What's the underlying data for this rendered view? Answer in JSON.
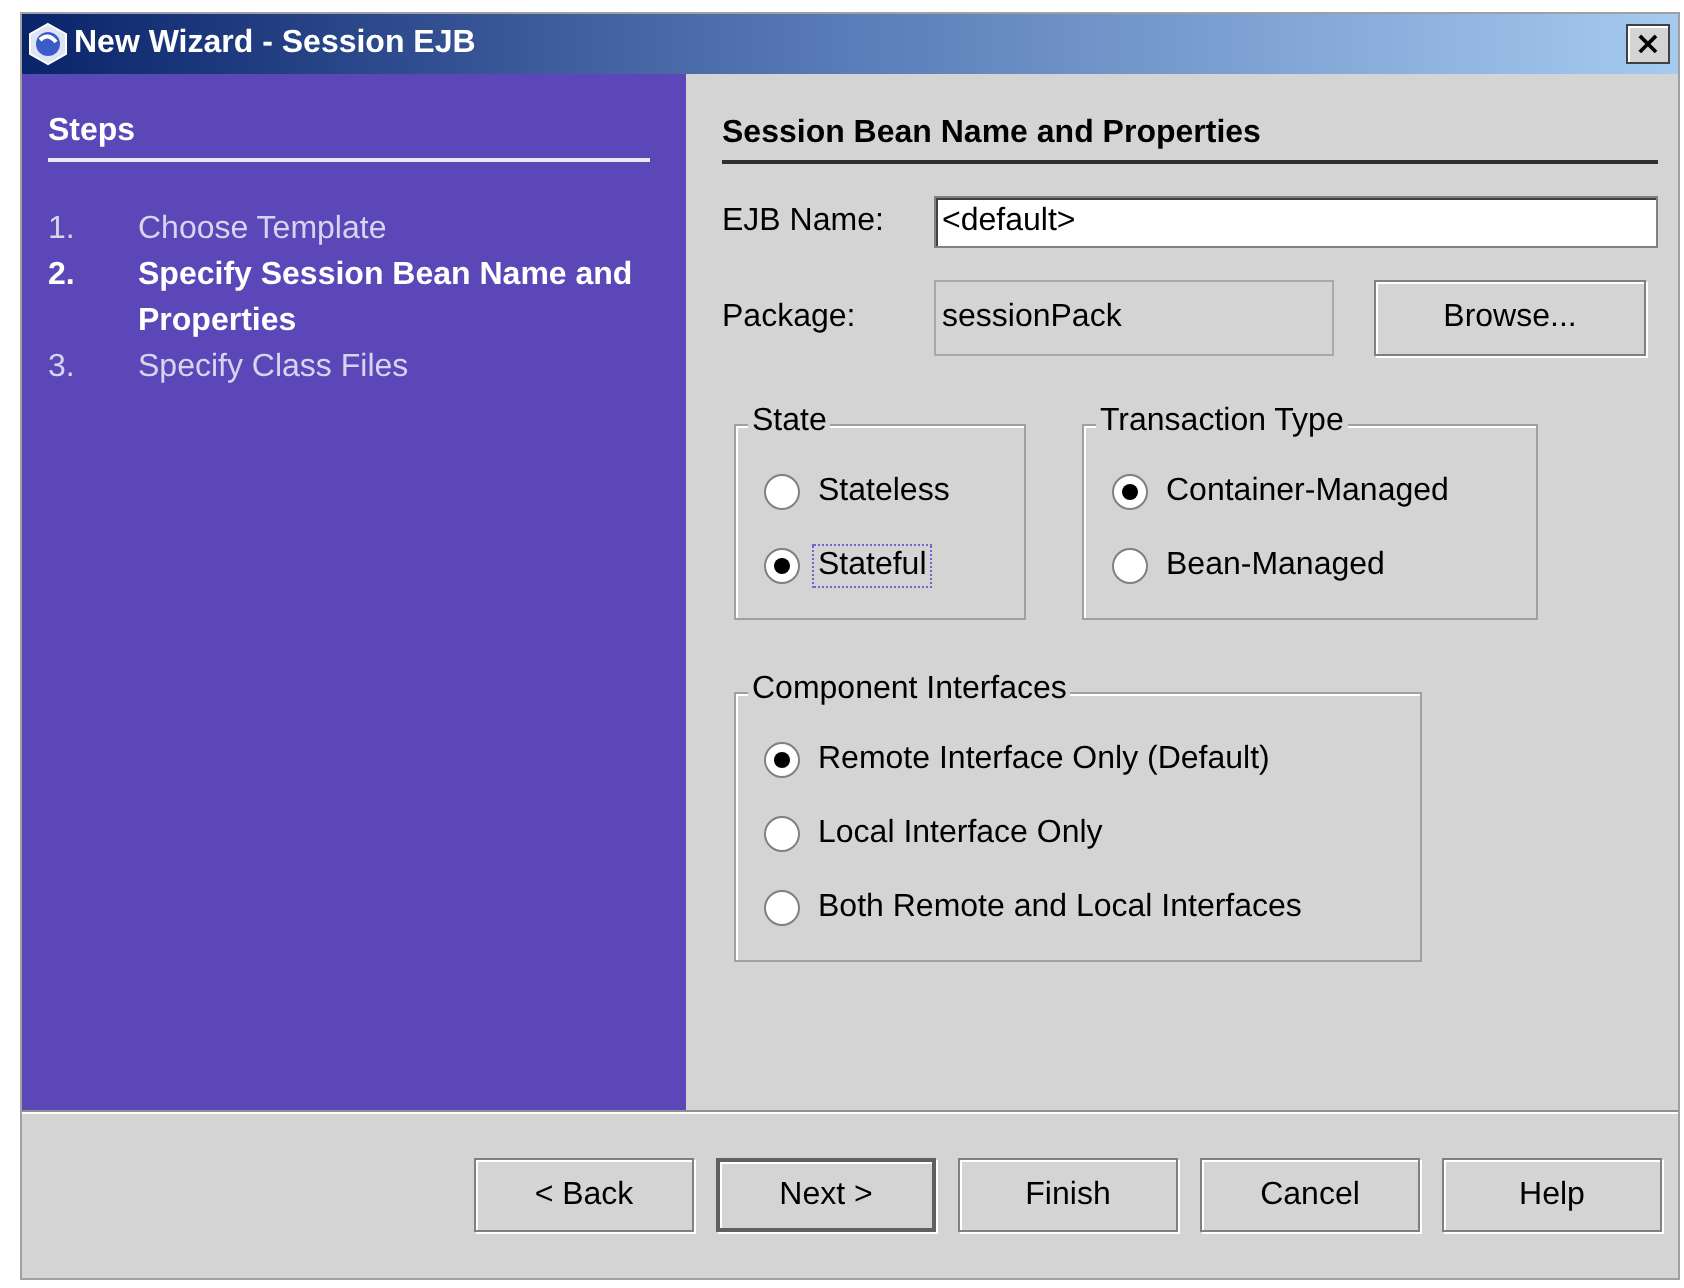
{
  "window": {
    "title": "New Wizard - Session EJB",
    "close": "×"
  },
  "steps": {
    "title": "Steps",
    "items": [
      {
        "number": "1.",
        "label": "Choose Template",
        "current": false
      },
      {
        "number": "2.",
        "label": "Specify Session Bean Name and Properties",
        "current": true
      },
      {
        "number": "3.",
        "label": "Specify Class Files",
        "current": false
      }
    ]
  },
  "panel": {
    "heading": "Session Bean Name and Properties",
    "fields": [
      {
        "label": "EJB Name:",
        "value": "<default>",
        "disabled": false
      },
      {
        "label": "Package:",
        "value": "sessionPack",
        "disabled": true,
        "button": "Browse..."
      }
    ],
    "groups": [
      {
        "title": "State",
        "options": [
          {
            "label": "Stateless",
            "selected": false,
            "focused": false
          },
          {
            "label": "Stateful",
            "selected": true,
            "focused": true
          }
        ]
      },
      {
        "title": "Transaction Type",
        "options": [
          {
            "label": "Container-Managed",
            "selected": true,
            "focused": false
          },
          {
            "label": "Bean-Managed",
            "selected": false,
            "focused": false
          }
        ]
      },
      {
        "title": "Component Interfaces",
        "options": [
          {
            "label": "Remote Interface Only (Default)",
            "selected": true,
            "focused": false
          },
          {
            "label": "Local Interface Only",
            "selected": false,
            "focused": false
          },
          {
            "label": "Both Remote and Local Interfaces",
            "selected": false,
            "focused": false
          }
        ]
      }
    ]
  },
  "buttons": [
    {
      "label": "< Back",
      "default": false
    },
    {
      "label": "Next >",
      "default": true
    },
    {
      "label": "Finish",
      "default": false
    },
    {
      "label": "Cancel",
      "default": false
    },
    {
      "label": "Help",
      "default": false
    }
  ]
}
